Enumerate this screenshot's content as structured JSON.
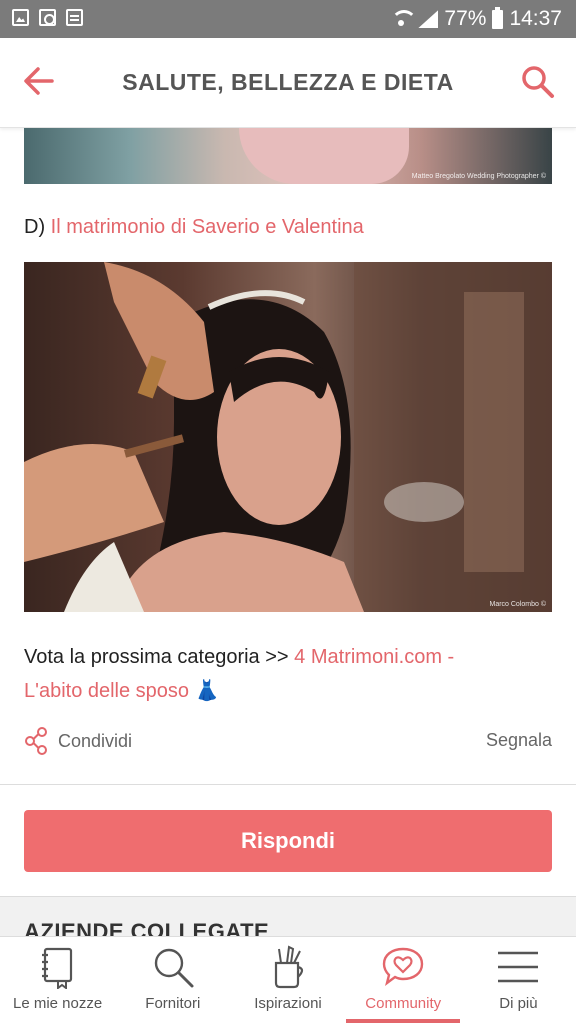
{
  "status_bar": {
    "left_icons": [
      "image-icon",
      "shopping-bag-icon",
      "calendar-icon"
    ],
    "battery_percent": "77%",
    "time": "14:37"
  },
  "header": {
    "title": "SALUTE, BELLEZZA E DIETA",
    "back_icon": "arrow-left-icon",
    "search_icon": "search-icon"
  },
  "post": {
    "photo1_credit": "Matteo Bregolato Wedding Photographer ©",
    "option_prefix": "D)",
    "option_link": "Il matrimonio di Saverio e Valentina",
    "photo2_credit": "Marco Colombo ©",
    "vote_text": "Vota la prossima categoria >>",
    "vote_link_line1": "4 Matrimoni.com -",
    "vote_link_line2": "L'abito delle sposo 👗",
    "share_label": "Condividi",
    "report_label": "Segnala"
  },
  "reply_button": "Rispondi",
  "section_title": "AZIENDE COLLEGATE",
  "bottom_nav": {
    "items": [
      {
        "label": "Le mie nozze",
        "icon": "notebook-icon"
      },
      {
        "label": "Fornitori",
        "icon": "search-icon"
      },
      {
        "label": "Ispirazioni",
        "icon": "brush-cup-icon"
      },
      {
        "label": "Community",
        "icon": "heart-chat-icon",
        "active": true
      },
      {
        "label": "Di più",
        "icon": "menu-icon"
      }
    ]
  },
  "colors": {
    "accent": "#e3666b",
    "button": "#ef6d6f",
    "status_bar": "#7b7b7b"
  }
}
